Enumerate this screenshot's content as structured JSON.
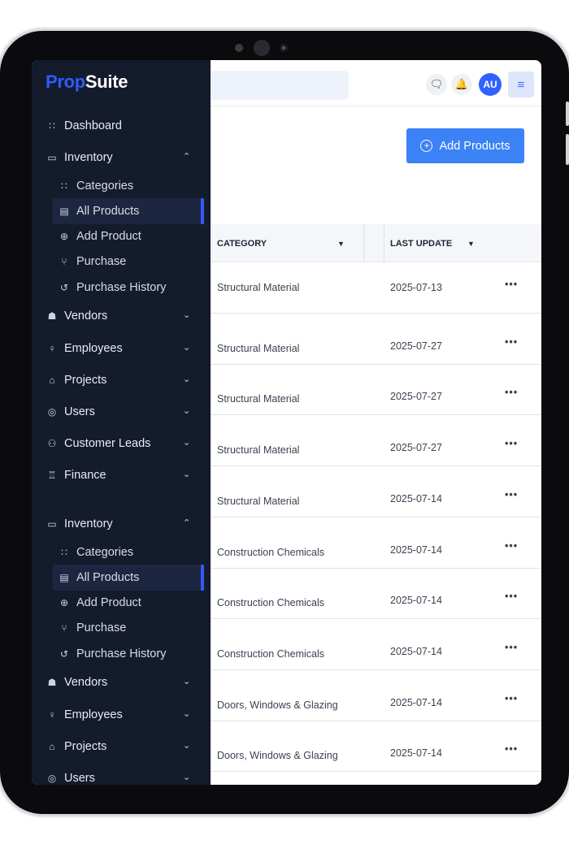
{
  "app": {
    "logo_part1": "Prop",
    "logo_part2": "Suite"
  },
  "header": {
    "user_initials": "AU"
  },
  "toolbar": {
    "add_products_label": "Add Products"
  },
  "sidebar": {
    "items": [
      {
        "label": "Dashboard",
        "icon": "grid-icon",
        "level": "top",
        "chevron": ""
      },
      {
        "label": "Inventory",
        "icon": "folder-icon",
        "level": "top",
        "chevron": "up"
      },
      {
        "label": "Categories",
        "icon": "grid-icon",
        "level": "sub"
      },
      {
        "label": "All Products",
        "icon": "archive-icon",
        "level": "sub",
        "active": true
      },
      {
        "label": "Add Product",
        "icon": "plus-circle-icon",
        "level": "sub"
      },
      {
        "label": "Purchase",
        "icon": "cart-icon",
        "level": "sub"
      },
      {
        "label": "Purchase History",
        "icon": "history-icon",
        "level": "sub"
      },
      {
        "label": "Vendors",
        "icon": "vendors-icon",
        "level": "top",
        "chevron": "down"
      },
      {
        "label": "Employees",
        "icon": "user-icon",
        "level": "top",
        "chevron": "down"
      },
      {
        "label": "Projects",
        "icon": "home-icon",
        "level": "top",
        "chevron": "down"
      },
      {
        "label": "Users",
        "icon": "user-circle-icon",
        "level": "top",
        "chevron": "down"
      },
      {
        "label": "Customer Leads",
        "icon": "users-icon",
        "level": "top",
        "chevron": "down"
      },
      {
        "label": "Finance",
        "icon": "bank-icon",
        "level": "top",
        "chevron": "down"
      },
      {
        "label": "Inventory",
        "icon": "folder-icon",
        "level": "top",
        "chevron": "up"
      },
      {
        "label": "Categories",
        "icon": "grid-icon",
        "level": "sub"
      },
      {
        "label": "All Products",
        "icon": "archive-icon",
        "level": "sub",
        "active": true
      },
      {
        "label": "Add Product",
        "icon": "plus-circle-icon",
        "level": "sub"
      },
      {
        "label": "Purchase",
        "icon": "cart-icon",
        "level": "sub"
      },
      {
        "label": "Purchase History",
        "icon": "history-icon",
        "level": "sub"
      },
      {
        "label": "Vendors",
        "icon": "vendors-icon",
        "level": "top",
        "chevron": "down"
      },
      {
        "label": "Employees",
        "icon": "user-icon",
        "level": "top",
        "chevron": "down"
      },
      {
        "label": "Projects",
        "icon": "home-icon",
        "level": "top",
        "chevron": "down"
      },
      {
        "label": "Users",
        "icon": "user-circle-icon",
        "level": "top",
        "chevron": "down"
      }
    ]
  },
  "table": {
    "columns": [
      "CATEGORY",
      "LAST UPDATE"
    ],
    "rows": [
      {
        "category": "Structural Material",
        "last_update": "2025-07-13"
      },
      {
        "category": "Structural Material",
        "last_update": "2025-07-27"
      },
      {
        "category": "Structural Material",
        "last_update": "2025-07-27"
      },
      {
        "category": "Structural Material",
        "last_update": "2025-07-27"
      },
      {
        "category": "Structural Material",
        "last_update": "2025-07-14"
      },
      {
        "category": "Construction Chemicals",
        "last_update": "2025-07-14"
      },
      {
        "category": "Construction Chemicals",
        "last_update": "2025-07-14"
      },
      {
        "category": "Construction Chemicals",
        "last_update": "2025-07-14"
      },
      {
        "category": "Doors, Windows & Glazing",
        "last_update": "2025-07-14"
      },
      {
        "category": "Doors, Windows & Glazing",
        "last_update": "2025-07-14"
      }
    ],
    "row_action": "•••"
  }
}
